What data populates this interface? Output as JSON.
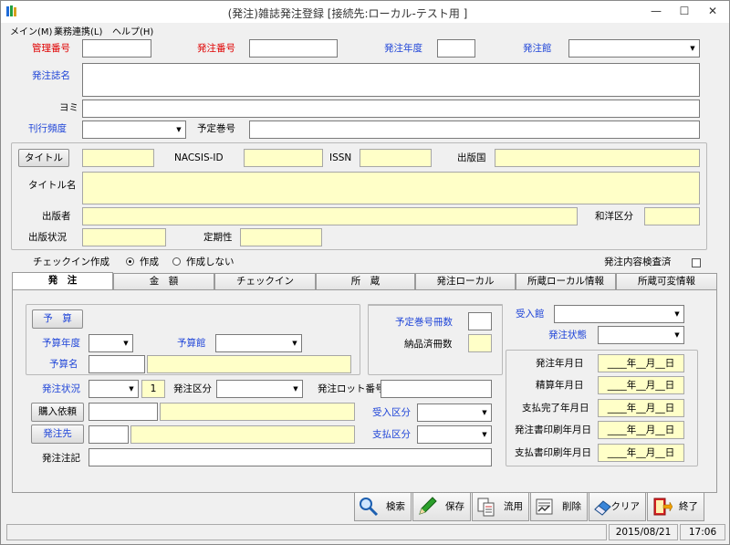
{
  "window": {
    "title": "(発注)雑誌発注登録 [接続先:ローカル-テスト用 ]",
    "minimize": "—",
    "restore": "☐",
    "close": "✕"
  },
  "menu": [
    "メイン(M)",
    "業務連携(L)",
    "ヘルプ(H)"
  ],
  "header": {
    "kanri_label": "管理番号",
    "hatchu_no_label": "発注番号",
    "year_label": "発注年度",
    "branch_label": "発注館",
    "title_label": "発注誌名",
    "yomi_label": "ヨミ",
    "freq_label": "刊行頻度",
    "vol_label": "予定巻号"
  },
  "biblio": {
    "title_button": "タイトル",
    "nacsis_label": "NACSIS-ID",
    "issn_label": "ISSN",
    "country_label": "出版国",
    "titlename_label": "タイトル名",
    "publisher_label": "出版者",
    "wayo_label": "和洋区分",
    "pubstatus_label": "出版状況",
    "periodical_label": "定期性"
  },
  "checkin": {
    "label": "チェックイン作成",
    "opt_create": "作成",
    "opt_nocreate": "作成しない",
    "inspect_label": "発注内容検査済"
  },
  "tabs": [
    "発　注",
    "金　額",
    "チェックイン",
    "所　蔵",
    "発注ローカル",
    "所蔵ローカル情報",
    "所蔵可変情報"
  ],
  "order": {
    "budget_button": "予　算",
    "budget_year_label": "予算年度",
    "budget_branch_label": "予算館",
    "budget_name_label": "予算名",
    "vol_count_label": "予定巻号冊数",
    "delivered_label": "納品済冊数",
    "receive_branch_label": "受入館",
    "order_state_label": "発注状態",
    "order_status_label": "発注状況",
    "order_status_value": "1",
    "order_type_label": "発注区分",
    "lot_label": "発注ロット番号",
    "purchase_button": "購入依頼",
    "receive_type_label": "受入区分",
    "vendor_button": "発注先",
    "payment_type_label": "支払区分",
    "note_label": "発注注記",
    "dates": [
      {
        "label": "発注年月日",
        "value": "____年__月__日"
      },
      {
        "label": "精算年月日",
        "value": "____年__月__日"
      },
      {
        "label": "支払完了年月日",
        "value": "____年__月__日"
      },
      {
        "label": "発注書印刷年月日",
        "value": "____年__月__日"
      },
      {
        "label": "支払書印刷年月日",
        "value": "____年__月__日"
      }
    ]
  },
  "actions": [
    {
      "label": "検索",
      "icon": "magnifier-icon"
    },
    {
      "label": "保存",
      "icon": "pencil-icon"
    },
    {
      "label": "流用",
      "icon": "copy-documents-icon"
    },
    {
      "label": "削除",
      "icon": "delete-document-icon"
    },
    {
      "label": "クリア",
      "icon": "eraser-icon"
    },
    {
      "label": "終了",
      "icon": "exit-door-icon"
    }
  ],
  "status": {
    "date": "2015/08/21",
    "time": "17:06"
  }
}
